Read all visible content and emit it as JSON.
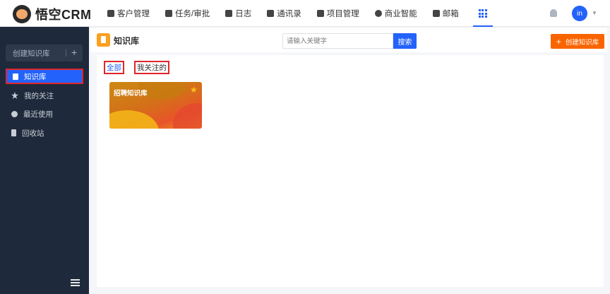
{
  "app": {
    "brand": "悟空CRM"
  },
  "nav": {
    "items": [
      {
        "label": "客户管理",
        "icon": "customer-icon"
      },
      {
        "label": "任务/审批",
        "icon": "task-icon"
      },
      {
        "label": "日志",
        "icon": "log-icon"
      },
      {
        "label": "通讯录",
        "icon": "contacts-icon"
      },
      {
        "label": "项目管理",
        "icon": "project-icon"
      },
      {
        "label": "商业智能",
        "icon": "bi-icon"
      },
      {
        "label": "邮箱",
        "icon": "mail-icon"
      }
    ],
    "apps_icon": "grid-icon"
  },
  "user": {
    "avatar_text": "in"
  },
  "sidebar": {
    "create_label": "创建知识库",
    "items": [
      {
        "label": "知识库",
        "icon": "book-icon",
        "active": true
      },
      {
        "label": "我的关注",
        "icon": "star-icon",
        "active": false
      },
      {
        "label": "最近使用",
        "icon": "clock-icon",
        "active": false
      },
      {
        "label": "回收站",
        "icon": "trash-icon",
        "active": false
      }
    ]
  },
  "header": {
    "title": "知识库",
    "search_placeholder": "请输入关键字",
    "search_button": "搜索",
    "create_button": "创建知识库"
  },
  "tabs": [
    {
      "label": "全部",
      "active": true
    },
    {
      "label": "我关注的",
      "active": false
    }
  ],
  "cards": [
    {
      "title": "招聘知识库",
      "starred": true
    }
  ],
  "colors": {
    "primary": "#2362fb",
    "accent": "#fa6400",
    "sidebar_bg": "#1e2a3b",
    "highlight_border": "#e0262b"
  }
}
